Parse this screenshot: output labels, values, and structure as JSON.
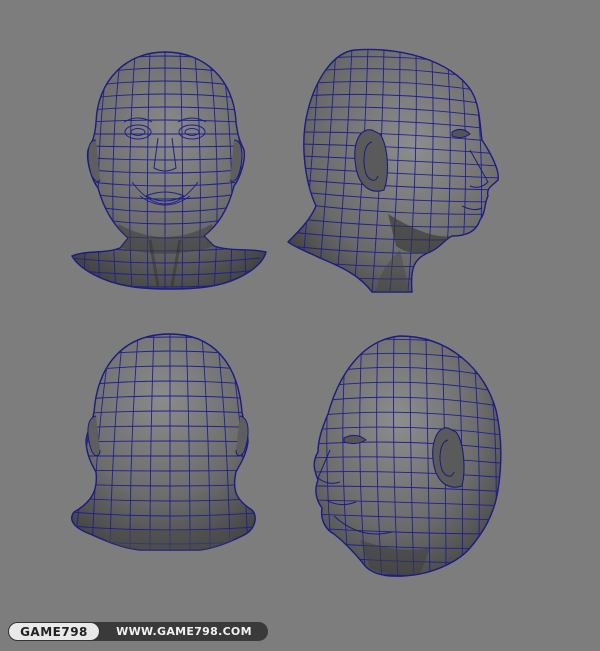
{
  "watermark": {
    "brand": "GAME798",
    "url": "WWW.GAME798.COM"
  },
  "colors": {
    "background": "#7d7d7d",
    "mesh_fill": "#6e6e6e",
    "mesh_shade": "#4a4a4a",
    "wire": "#1e1e8a",
    "footer_dark": "#3a3a3a",
    "footer_light": "#e9e9e9"
  },
  "views": [
    {
      "name": "front-view"
    },
    {
      "name": "side-view-right"
    },
    {
      "name": "back-view"
    },
    {
      "name": "three-quarter-view-left"
    }
  ]
}
